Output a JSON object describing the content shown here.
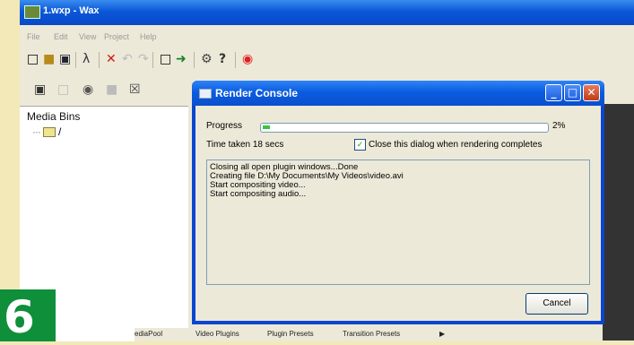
{
  "app": {
    "title": "1.wxp - Wax"
  },
  "menu": [
    "File",
    "Edit",
    "View",
    "Project",
    "Help"
  ],
  "toolbar1": [
    "new-icon",
    "open-icon",
    "save-icon",
    "wizard-icon",
    "delete-icon",
    "undo-icon",
    "redo-icon",
    "window-icon",
    "export-icon",
    "settings-icon",
    "help-icon",
    "render-icon"
  ],
  "toolbar2": [
    "add-media-icon",
    "media-icon",
    "plugin-icon",
    "folder-icon",
    "remove-icon"
  ],
  "left_panel": {
    "title": "Media Bins",
    "tree_item": "/"
  },
  "bottom_tabs": [
    "ediaPool",
    "Video Plugins",
    "Plugin Presets",
    "Transition Presets",
    "▶"
  ],
  "step_number": "6",
  "dialog": {
    "title": "Render Console",
    "progress_label": "Progress",
    "progress_value": 0.02,
    "progress_percent": "2%",
    "time_label": "Time taken  18 secs",
    "close_checkbox_label": "Close this dialog when rendering completes",
    "close_checked": true,
    "log": [
      "Closing all open plugin windows...Done",
      "Creating file D:\\My Documents\\My Videos\\video.avi",
      "Start compositing video...",
      "Start compositing audio..."
    ],
    "cancel_label": "Cancel"
  },
  "colors": {
    "xp_blue": "#0a58d8",
    "progress_green": "#35c63d",
    "step_badge": "#0f8f3a",
    "page_bg": "#f3e9b8"
  }
}
